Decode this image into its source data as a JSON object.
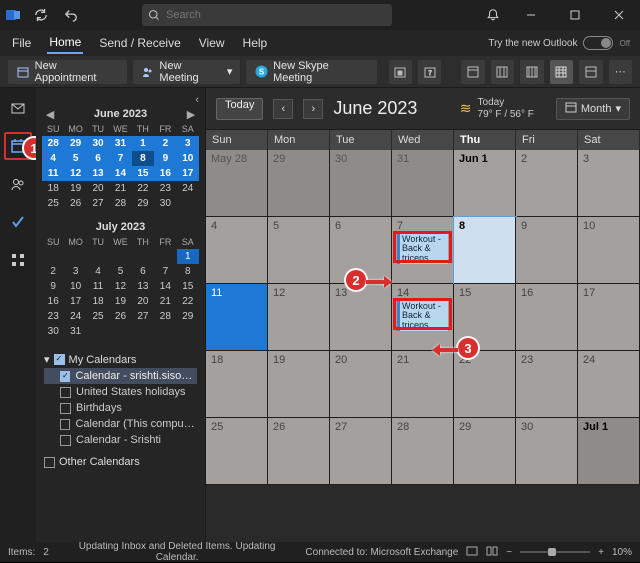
{
  "titlebar": {
    "search_placeholder": "Search"
  },
  "menu": {
    "file": "File",
    "home": "Home",
    "sendrec": "Send / Receive",
    "view": "View",
    "help": "Help",
    "try_new": "Try the new Outlook",
    "toggle_state": "Off"
  },
  "ribbon": {
    "new_appt": "New Appointment",
    "new_meeting": "New Meeting",
    "new_skype": "New Skype Meeting"
  },
  "mini1": {
    "title": "June 2023",
    "dow": [
      "SU",
      "MO",
      "TU",
      "WE",
      "TH",
      "FR",
      "SA"
    ],
    "rows": [
      [
        {
          "n": "28",
          "c": "blue"
        },
        {
          "n": "29",
          "c": "blue"
        },
        {
          "n": "30",
          "c": "blue"
        },
        {
          "n": "31",
          "c": "blue"
        },
        {
          "n": "1",
          "c": "blue"
        },
        {
          "n": "2",
          "c": "blue"
        },
        {
          "n": "3",
          "c": "blue"
        }
      ],
      [
        {
          "n": "4",
          "c": "blue"
        },
        {
          "n": "5",
          "c": "blue"
        },
        {
          "n": "6",
          "c": "blue"
        },
        {
          "n": "7",
          "c": "blue"
        },
        {
          "n": "8",
          "c": "today"
        },
        {
          "n": "9",
          "c": "blue"
        },
        {
          "n": "10",
          "c": "blue"
        }
      ],
      [
        {
          "n": "11",
          "c": "blue"
        },
        {
          "n": "12",
          "c": "blue"
        },
        {
          "n": "13",
          "c": "blue"
        },
        {
          "n": "14",
          "c": "blue"
        },
        {
          "n": "15",
          "c": "blue"
        },
        {
          "n": "16",
          "c": "blue"
        },
        {
          "n": "17",
          "c": "blue"
        }
      ],
      [
        {
          "n": "18",
          "c": ""
        },
        {
          "n": "19",
          "c": ""
        },
        {
          "n": "20",
          "c": ""
        },
        {
          "n": "21",
          "c": ""
        },
        {
          "n": "22",
          "c": ""
        },
        {
          "n": "23",
          "c": ""
        },
        {
          "n": "24",
          "c": ""
        }
      ],
      [
        {
          "n": "25",
          "c": ""
        },
        {
          "n": "26",
          "c": ""
        },
        {
          "n": "27",
          "c": ""
        },
        {
          "n": "28",
          "c": ""
        },
        {
          "n": "29",
          "c": ""
        },
        {
          "n": "30",
          "c": ""
        },
        {
          "n": "",
          "c": ""
        }
      ]
    ]
  },
  "mini2": {
    "title": "July 2023",
    "dow": [
      "SU",
      "MO",
      "TU",
      "WE",
      "TH",
      "FR",
      "SA"
    ],
    "rows": [
      [
        {
          "n": "",
          "c": ""
        },
        {
          "n": "",
          "c": ""
        },
        {
          "n": "",
          "c": ""
        },
        {
          "n": "",
          "c": ""
        },
        {
          "n": "",
          "c": ""
        },
        {
          "n": "",
          "c": ""
        },
        {
          "n": "1",
          "c": "sel1"
        }
      ],
      [
        {
          "n": "2",
          "c": ""
        },
        {
          "n": "3",
          "c": ""
        },
        {
          "n": "4",
          "c": ""
        },
        {
          "n": "5",
          "c": ""
        },
        {
          "n": "6",
          "c": ""
        },
        {
          "n": "7",
          "c": ""
        },
        {
          "n": "8",
          "c": ""
        }
      ],
      [
        {
          "n": "9",
          "c": ""
        },
        {
          "n": "10",
          "c": ""
        },
        {
          "n": "11",
          "c": ""
        },
        {
          "n": "12",
          "c": ""
        },
        {
          "n": "13",
          "c": ""
        },
        {
          "n": "14",
          "c": ""
        },
        {
          "n": "15",
          "c": ""
        }
      ],
      [
        {
          "n": "16",
          "c": ""
        },
        {
          "n": "17",
          "c": ""
        },
        {
          "n": "18",
          "c": ""
        },
        {
          "n": "19",
          "c": ""
        },
        {
          "n": "20",
          "c": ""
        },
        {
          "n": "21",
          "c": ""
        },
        {
          "n": "22",
          "c": ""
        }
      ],
      [
        {
          "n": "23",
          "c": ""
        },
        {
          "n": "24",
          "c": ""
        },
        {
          "n": "25",
          "c": ""
        },
        {
          "n": "26",
          "c": ""
        },
        {
          "n": "27",
          "c": ""
        },
        {
          "n": "28",
          "c": ""
        },
        {
          "n": "29",
          "c": ""
        }
      ],
      [
        {
          "n": "30",
          "c": ""
        },
        {
          "n": "31",
          "c": ""
        },
        {
          "n": "",
          "c": ""
        },
        {
          "n": "",
          "c": ""
        },
        {
          "n": "",
          "c": ""
        },
        {
          "n": "",
          "c": ""
        },
        {
          "n": "",
          "c": ""
        }
      ]
    ]
  },
  "calendars": {
    "group1": "My Calendars",
    "items": [
      {
        "label": "Calendar - srishti.sisodia...",
        "chk": true,
        "sel": true
      },
      {
        "label": "United States holidays",
        "chk": false
      },
      {
        "label": "Birthdays",
        "chk": false
      },
      {
        "label": "Calendar (This computer...",
        "chk": false
      },
      {
        "label": "Calendar - Srishti",
        "chk": false
      }
    ],
    "group2": "Other Calendars"
  },
  "mainhdr": {
    "today": "Today",
    "title": "June 2023",
    "weather_day": "Today",
    "weather_temp": "79° F / 56° F",
    "range": "Month"
  },
  "gridhdr": [
    "Sun",
    "Mon",
    "Tue",
    "Wed",
    "Thu",
    "Fri",
    "Sat"
  ],
  "gridhdr_bold_index": 4,
  "cells": [
    {
      "n": "May 28",
      "dim": true
    },
    {
      "n": "29",
      "dim": true
    },
    {
      "n": "30",
      "dim": true
    },
    {
      "n": "31",
      "dim": true
    },
    {
      "n": "Jun 1",
      "flag": true
    },
    {
      "n": "2"
    },
    {
      "n": "3"
    },
    {
      "n": "4"
    },
    {
      "n": "5"
    },
    {
      "n": "6"
    },
    {
      "n": "7",
      "ev": "Workout - Back & triceps",
      "red": true
    },
    {
      "n": "8",
      "sel": true
    },
    {
      "n": "9"
    },
    {
      "n": "10"
    },
    {
      "n": "11",
      "blue": true
    },
    {
      "n": "12"
    },
    {
      "n": "13"
    },
    {
      "n": "14",
      "ev": "Workout - Back & triceps",
      "red": true
    },
    {
      "n": "15"
    },
    {
      "n": "16"
    },
    {
      "n": "17"
    },
    {
      "n": "18"
    },
    {
      "n": "19"
    },
    {
      "n": "20"
    },
    {
      "n": "21"
    },
    {
      "n": "22"
    },
    {
      "n": "23"
    },
    {
      "n": "24"
    },
    {
      "n": "25"
    },
    {
      "n": "26"
    },
    {
      "n": "27"
    },
    {
      "n": "28"
    },
    {
      "n": "29"
    },
    {
      "n": "30"
    },
    {
      "n": "Jul 1",
      "flag": true,
      "dim": true
    }
  ],
  "callouts": {
    "c1": "1",
    "c2": "2",
    "c3": "3"
  },
  "status": {
    "items_label": "Items:",
    "items_count": "2",
    "center": "Updating Inbox and Deleted Items.  Updating Calendar.",
    "conn": "Connected to: Microsoft Exchange",
    "zoom": "10%"
  }
}
